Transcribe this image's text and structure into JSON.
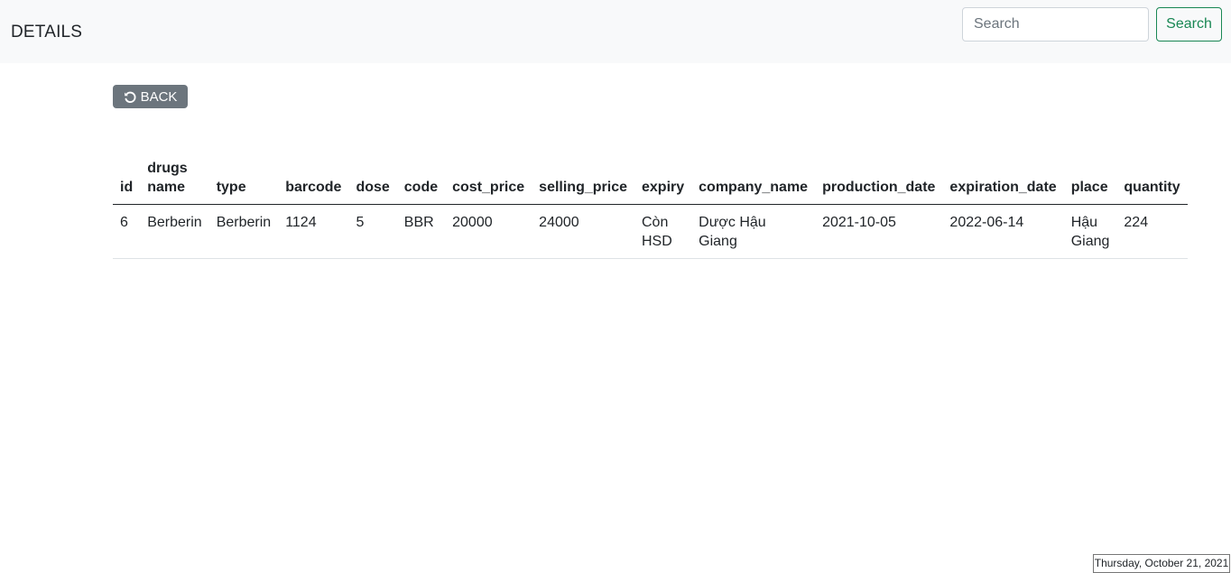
{
  "navbar": {
    "brand": "DETAILS",
    "search_placeholder": "Search",
    "search_button": "Search"
  },
  "back_button": {
    "label": "BACK",
    "icon": "undo-icon"
  },
  "table": {
    "headers": [
      "id",
      "drugs name",
      "type",
      "barcode",
      "dose",
      "code",
      "cost_price",
      "selling_price",
      "expiry",
      "company_name",
      "production_date",
      "expiration_date",
      "place",
      "quantity"
    ],
    "rows": [
      [
        "6",
        "Berberin",
        "Berberin",
        "1124",
        "5",
        "BBR",
        "20000",
        "24000",
        "Còn HSD",
        "Dược Hậu Giang",
        "2021-10-05",
        "2022-06-14",
        "Hậu Giang",
        "224"
      ]
    ]
  },
  "date_badge": "Thursday, October 21, 2021",
  "colors": {
    "navbar_bg": "#f8f9fa",
    "success": "#198754",
    "secondary": "#6c757d"
  }
}
